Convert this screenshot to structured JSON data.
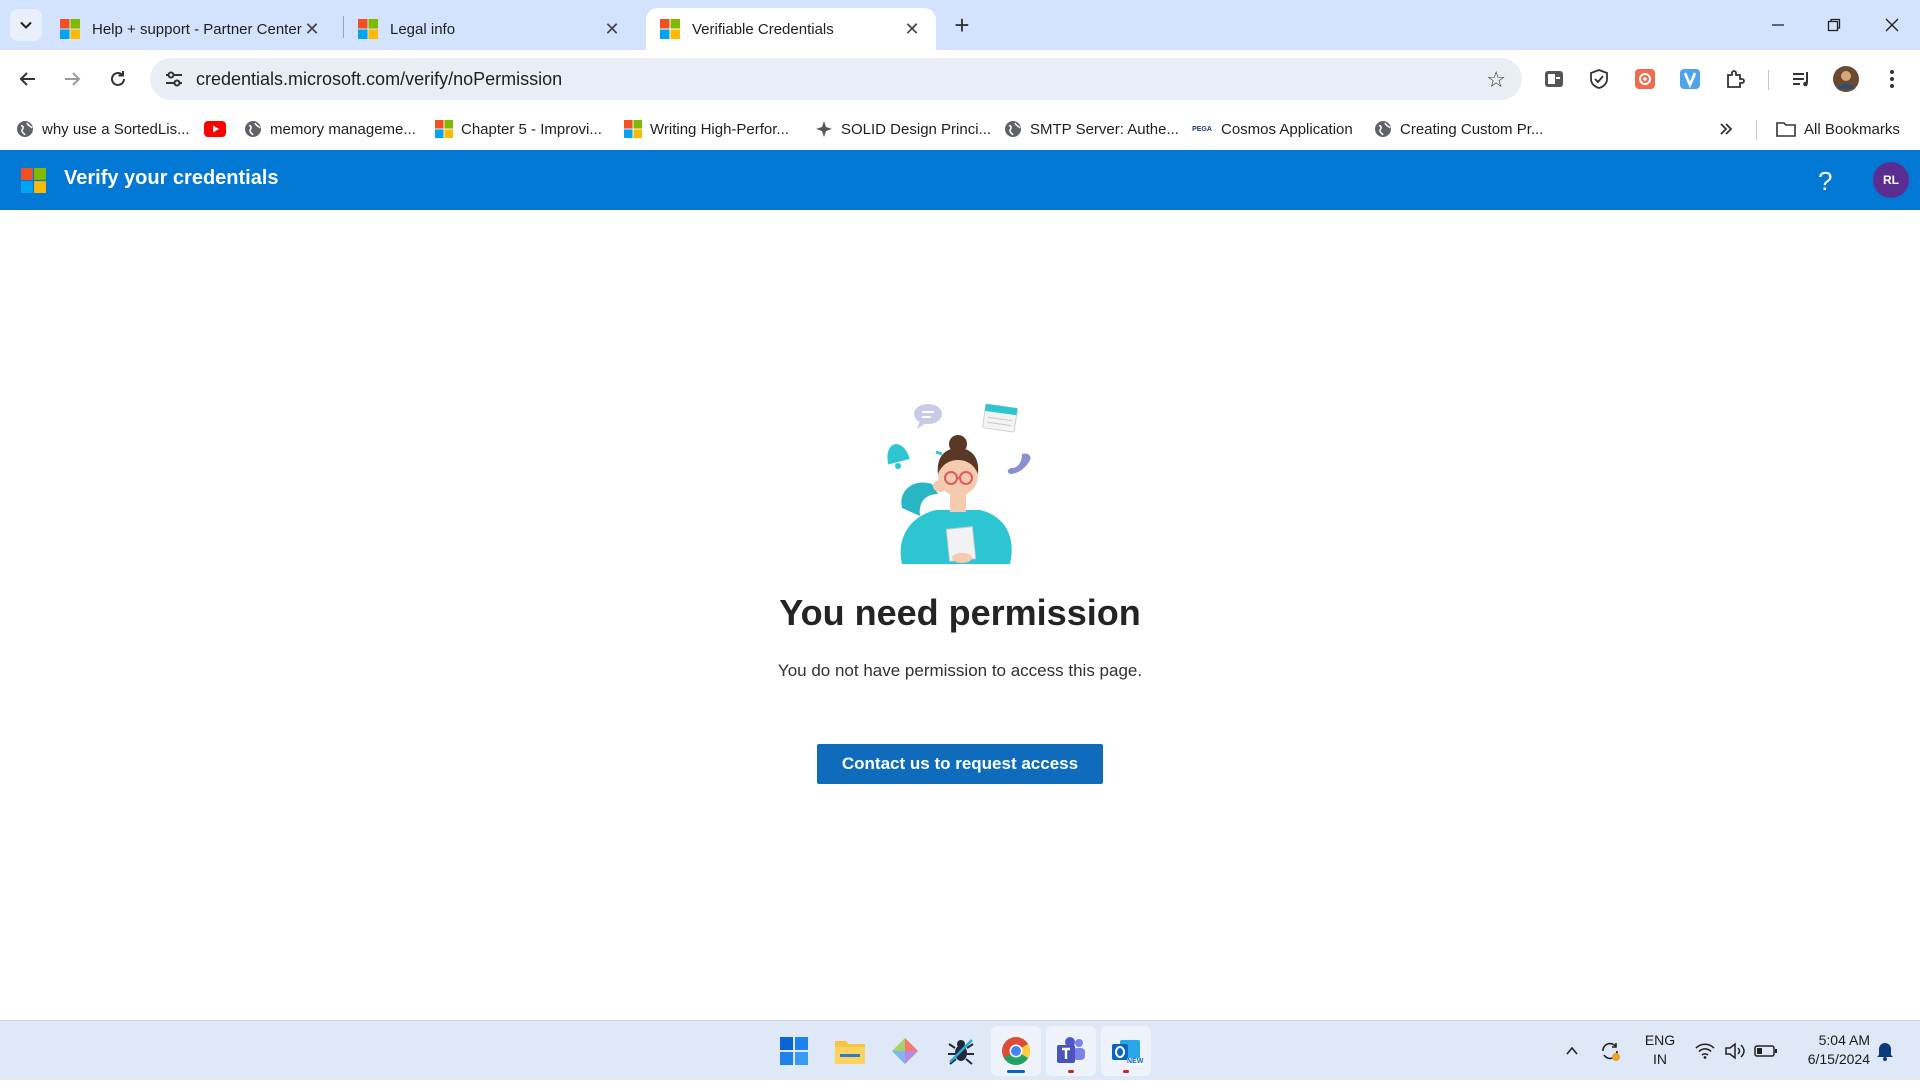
{
  "browser": {
    "tabs": [
      {
        "title": "Help + support - Partner Center",
        "active": false
      },
      {
        "title": "Legal info",
        "active": false
      },
      {
        "title": "Verifiable Credentials",
        "active": true
      }
    ],
    "url": "credentials.microsoft.com/verify/noPermission",
    "bookmarks": [
      {
        "label": "why use a SortedLis...",
        "icon": "globe-icon"
      },
      {
        "label": "",
        "icon": "youtube-icon"
      },
      {
        "label": "memory manageme...",
        "icon": "globe-icon"
      },
      {
        "label": "Chapter 5 - Improvi...",
        "icon": "microsoft-logo-icon"
      },
      {
        "label": "Writing High-Perfor...",
        "icon": "microsoft-logo-icon"
      },
      {
        "label": "SOLID Design Princi...",
        "icon": "star-burst-icon"
      },
      {
        "label": "SMTP Server: Authe...",
        "icon": "globe-icon"
      },
      {
        "label": "Cosmos Application",
        "icon": "pega-icon"
      },
      {
        "label": "Creating Custom Pr...",
        "icon": "globe-icon"
      }
    ],
    "pega_text": "PEGA",
    "all_bookmarks": "All Bookmarks"
  },
  "app": {
    "title": "Verify your credentials",
    "help": "?",
    "avatar_initials": "RL",
    "brand_color": "#0078d4"
  },
  "main": {
    "title": "You need permission",
    "description": "You do not have permission to access this page.",
    "cta_label": "Contact us to request access",
    "cta_color": "#0f6cbd"
  },
  "taskbar": {
    "apps": [
      "start-icon",
      "file-explorer-icon",
      "git-icon",
      "debugger-icon",
      "chrome-icon",
      "teams-icon",
      "outlook-icon"
    ],
    "outlook_badge": "NEW",
    "lang_primary": "ENG",
    "lang_secondary": "IN",
    "time": "5:04 AM",
    "date": "6/15/2024"
  }
}
